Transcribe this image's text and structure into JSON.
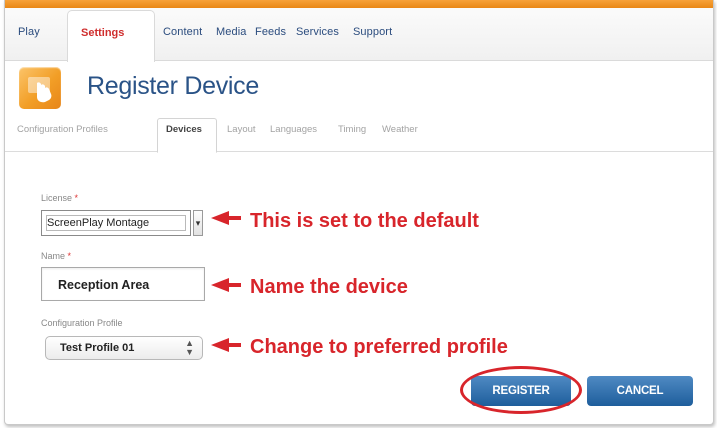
{
  "nav": {
    "items": [
      "Play",
      "Settings",
      "Content",
      "Media",
      "Feeds",
      "Services",
      "Support"
    ],
    "active": "Settings"
  },
  "header": {
    "title": "Register Device"
  },
  "subtabs": {
    "items": [
      "Configuration Profiles",
      "Devices",
      "Layout",
      "Languages",
      "Timing",
      "Weather"
    ],
    "active": "Devices"
  },
  "form": {
    "license_label": "License",
    "license_value": "ScreenPlay Montage",
    "name_label": "Name",
    "name_value": "Reception Area",
    "profile_label": "Configuration Profile",
    "profile_value": "Test Profile 01",
    "required_marker": "*"
  },
  "annotations": {
    "license_note": "This is set to the default",
    "name_note": "Name the device",
    "profile_note": "Change to preferred profile"
  },
  "buttons": {
    "register": "REGISTER",
    "cancel": "CANCEL"
  },
  "colors": {
    "accent_orange": "#f29e26",
    "title_blue": "#2a5387",
    "annotation_red": "#d8252b",
    "button_blue": "#1e5e9c"
  },
  "icons": {
    "logo": "touch-screen-icon",
    "dropdown": "chevron-down-icon",
    "stepper": "up-down-arrows-icon"
  }
}
